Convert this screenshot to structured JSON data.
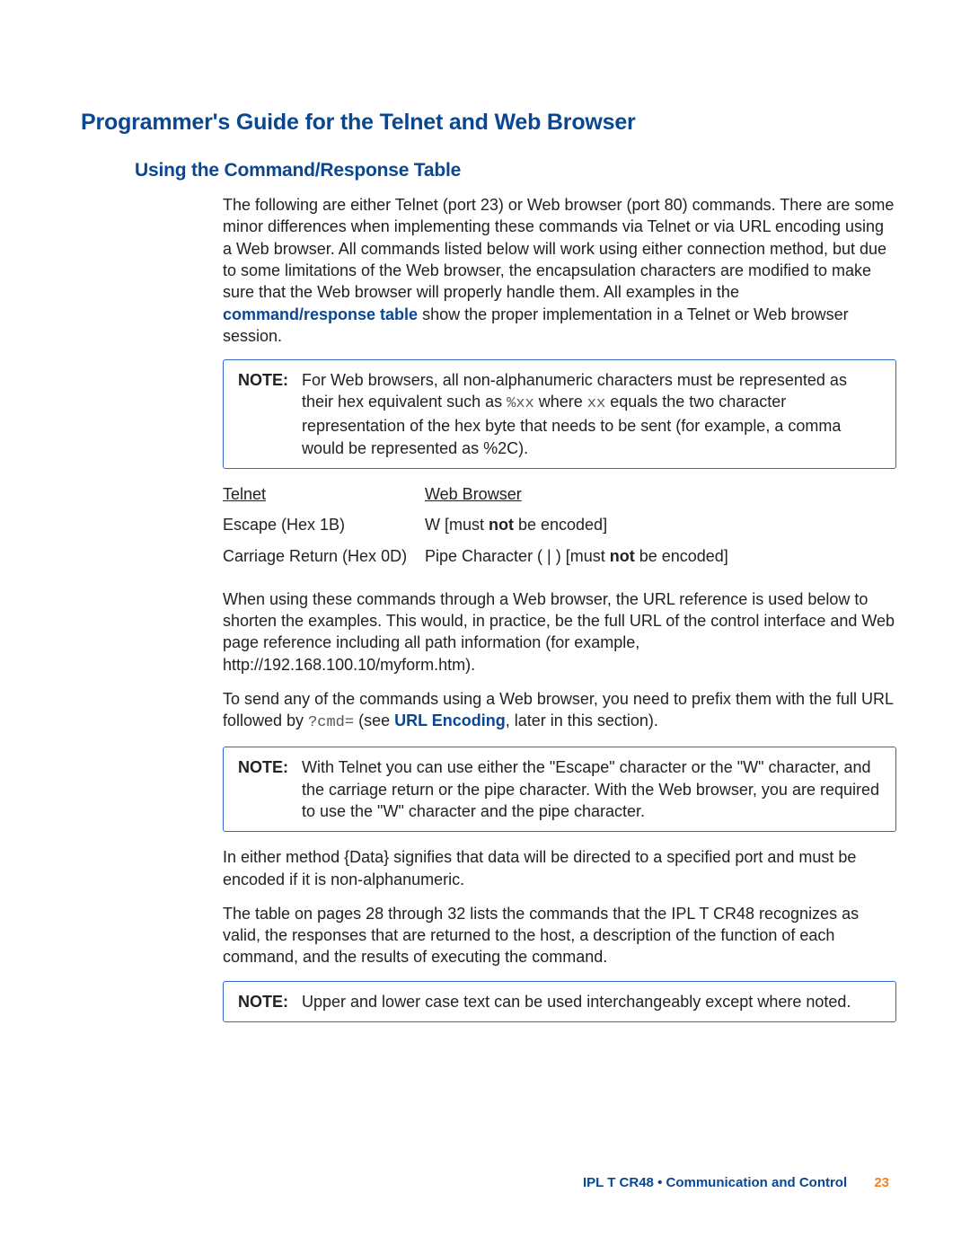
{
  "h1": "Programmer's Guide for the Telnet and Web Browser",
  "h2": "Using the Command/Response Table",
  "para1_a": "The following are either Telnet (port 23) or Web browser (port 80) commands. There are some minor differences when implementing these commands via Telnet or via URL encoding using a Web browser. All commands listed below will work using either connection method, but due to some limitations of the Web browser, the encapsulation characters are modified to make sure that the Web browser will properly handle them. All examples in the ",
  "para1_b_bold": "command/response table",
  "para1_c": " show the proper implementation in a Telnet or Web browser session.",
  "note1": {
    "label": "NOTE:",
    "t1": "For Web browsers, all non-alphanumeric characters must be represented as their hex equivalent such as ",
    "m1": "%xx",
    "t2": " where ",
    "m2": "xx",
    "t3": " equals the two character representation of the hex byte that needs to be sent (for example, a comma would be represented as %2C)."
  },
  "table": {
    "h_telnet": "Telnet",
    "h_web": "Web Browser",
    "r1_t": "Escape (Hex 1B)",
    "r1_w_a": "W [must ",
    "r1_w_b": "not",
    "r1_w_c": " be encoded]",
    "r2_t": "Carriage Return (Hex 0D)",
    "r2_w_a": "Pipe Character ( | ) [must ",
    "r2_w_b": "not",
    "r2_w_c": " be encoded]"
  },
  "para2": "When using these commands through a Web browser, the URL reference is used below to shorten the examples. This would, in practice, be the full URL of the control interface and Web page reference including all path information (for example, http://192.168.100.10/myform.htm).",
  "para3_a": "To send any of the commands using a Web browser, you need to prefix them with the full URL followed by ",
  "para3_m": "?cmd=",
  "para3_b": " (see ",
  "para3_link": "URL Encoding",
  "para3_c": ", later in this section).",
  "note2": {
    "label": "NOTE:",
    "text": "With Telnet you can use either the \"Escape\" character or the \"W\" character, and the carriage return or the pipe character. With the Web browser, you are required to use the \"W\" character and the pipe character."
  },
  "para4": "In either method {Data} signifies that data will be directed to a specified port and must be encoded if it is non-alphanumeric.",
  "para5": "The table on pages 28 through 32 lists the commands that the IPL T CR48 recognizes as valid, the responses that are returned to the host, a description of the function of each command, and the results of executing the command.",
  "note3": {
    "label": "NOTE:",
    "text": "Upper and lower case text can be used interchangeably except where noted."
  },
  "footer": {
    "text": "IPL T CR48 • Communication and Control",
    "page": "23"
  }
}
